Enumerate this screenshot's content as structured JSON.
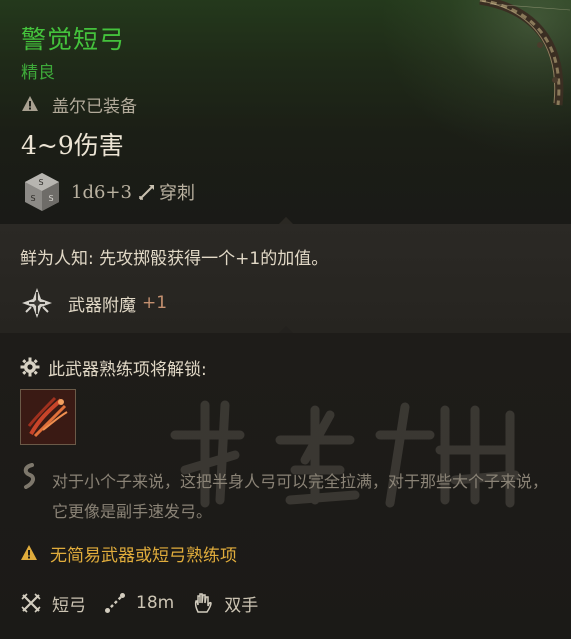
{
  "item": {
    "name": "警觉短弓",
    "rarity": "精良",
    "equipped_by": "盖尔已装备",
    "damage": "4~9伤害",
    "dice": "1d6+3",
    "damage_type": "穿刺"
  },
  "passive": {
    "text": "鲜为人知: 先攻掷骰获得一个+1的加值。",
    "enchant_label": "武器附魔",
    "enchant_value": "+1"
  },
  "proficiency": {
    "unlock_label": "此武器熟练项将解锁:",
    "flavor": "对于小个子来说，这把半身人弓可以完全拉满，对于那些大个子来说，它更像是副手速发弓。",
    "no_proficiency_warning": "无简易武器或短弓熟练项"
  },
  "stats": {
    "weapon_type": "短弓",
    "range": "18m",
    "handedness": "双手"
  },
  "colors": {
    "name": "#44c23c",
    "rarity": "#3ea93a",
    "warning": "#e0ac3c",
    "enchant_value": "#c49070"
  },
  "icons": {
    "equipped": "warning-triangle-icon",
    "dice": "dice-icon",
    "damage_type": "piercing-arrow-icon",
    "enchant": "weapon-enchant-icon",
    "unlock": "gear-icon",
    "action": "weapon-action-icon",
    "flavor": "quote-icon",
    "no_proficiency": "warning-triangle-icon",
    "weapon_type": "crossed-blades-icon",
    "range": "range-icon",
    "handedness": "hand-icon"
  }
}
